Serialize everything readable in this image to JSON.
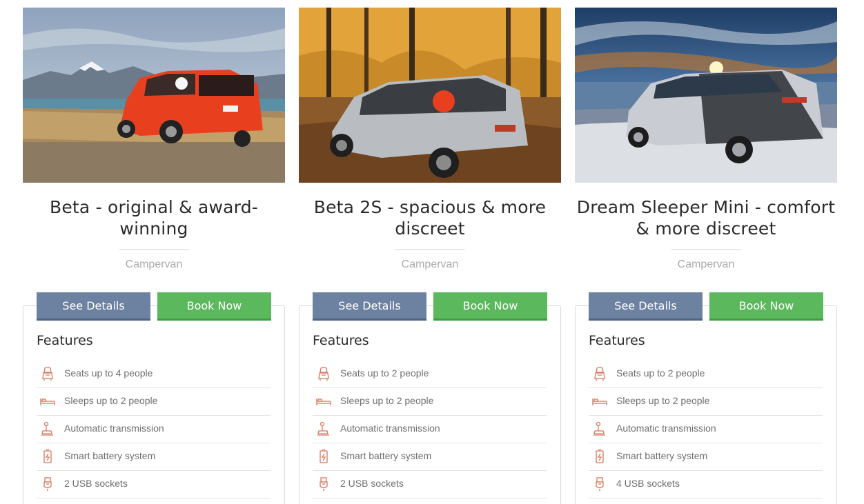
{
  "theme": {
    "icon_color": "#d9765a",
    "details_button_color": "#6d82a0",
    "book_button_color": "#5cb85c"
  },
  "cards": [
    {
      "photo": "orange-campervan-mountain-lake-photo",
      "title": "Beta - original & award-winning",
      "category": "Campervan",
      "details_label": "See Details",
      "book_label": "Book Now",
      "features_heading": "Features",
      "features": [
        {
          "icon": "car-seat-icon",
          "text": "Seats up to 4 people"
        },
        {
          "icon": "bed-icon",
          "text": "Sleeps up to 2 people"
        },
        {
          "icon": "gear-shift-icon",
          "text": "Automatic transmission"
        },
        {
          "icon": "battery-icon",
          "text": "Smart battery system"
        },
        {
          "icon": "usb-icon",
          "text": "2 USB sockets"
        }
      ]
    },
    {
      "photo": "silver-campervan-autumn-forest-photo",
      "title": "Beta 2S - spacious & more discreet",
      "category": "Campervan",
      "details_label": "See Details",
      "book_label": "Book Now",
      "features_heading": "Features",
      "features": [
        {
          "icon": "car-seat-icon",
          "text": "Seats up to 2 people"
        },
        {
          "icon": "bed-icon",
          "text": "Sleeps up to 2 people"
        },
        {
          "icon": "gear-shift-icon",
          "text": "Automatic transmission"
        },
        {
          "icon": "battery-icon",
          "text": "Smart battery system"
        },
        {
          "icon": "usb-icon",
          "text": "2 USB sockets"
        }
      ]
    },
    {
      "photo": "silver-campervan-sunset-beach-photo",
      "title": "Dream Sleeper Mini - comfort & more discreet",
      "category": "Campervan",
      "details_label": "See Details",
      "book_label": "Book Now",
      "features_heading": "Features",
      "features": [
        {
          "icon": "car-seat-icon",
          "text": "Seats up to 2 people"
        },
        {
          "icon": "bed-icon",
          "text": "Sleeps up to 2 people"
        },
        {
          "icon": "gear-shift-icon",
          "text": "Automatic transmission"
        },
        {
          "icon": "battery-icon",
          "text": "Smart battery system"
        },
        {
          "icon": "usb-icon",
          "text": "4 USB sockets"
        }
      ]
    }
  ]
}
